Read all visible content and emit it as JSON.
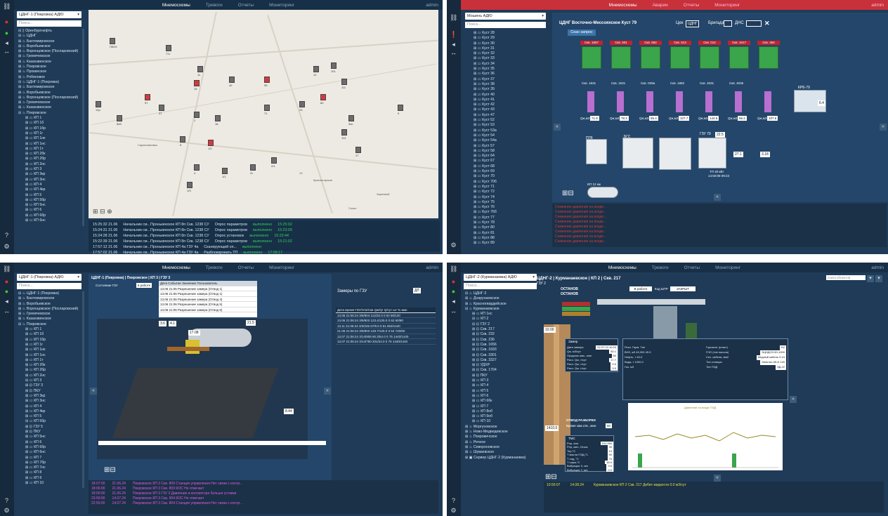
{
  "topnav": {
    "mnemo": "Мнемосхемы",
    "alarms": "Тревоги",
    "reports": "Отчеты",
    "monitoring": "Мониторинг",
    "user": "admin",
    "alarms2": "Аварии"
  },
  "q1": {
    "select": "ЦДНГ-1 (Покровка) АДЮ",
    "search": "Поиск...",
    "tree": [
      "⊟ ▯ Оренбургнефть",
      "⊟ ♨ ЦДНГ",
      "⊞ ♨ Бахтемировское",
      "⊞ ♨ Воробьевское",
      "⊞ ♨ Воронцовское (Посларовский)",
      "⊞ ♨ Гремячевское",
      "⊞ ♨ Казахзвенское",
      "⊞ ♨ Покровское",
      "⊞ ♨ Прокинское",
      "⊞ ♨ Рябиновое",
      "⊟ ♨ ЦДНГ-1 (Покровка)",
      "⊞ ♨ Бахтемировское",
      "⊞ ♨ Воробьевское",
      "⊞ ♨ Воронцовское (Посларовский)",
      "⊞ ♨ Гремячевское",
      "⊞ ♨ Казахзвенское",
      "⊟ ♨ Покровское",
      "⊞ ▭ КП 1",
      "⊞ ▭ КП 1б",
      "⊞ ▭ КП 1бр",
      "⊞ ▭ КП 1г",
      "⊞ ▭ КП 1нк",
      "⊞ ▭ КП 1нс",
      "⊞ ▭ КП 1т",
      "⊞ ▭ КП 2бк",
      "⊞ ▭ КП 2бр",
      "⊞ ▭ КП 2нс",
      "⊞ ▭ КП 3",
      "⊞ ▭ КП 3кр",
      "⊞ ▭ КП 3нс",
      "⊞ ▭ КП 4",
      "⊞ ▭ КП 4кр",
      "⊞ ▭ КП 5",
      "⊞ ▭ КП 5бр",
      "⊞ ▭ КП 5нс",
      "⊞ ▭ КП 6",
      "⊞ ▭ КП 6бр",
      "⊞ ▭ КП 6нс"
    ],
    "map_labels": [
      "ПКОХ",
      "71т",
      "11",
      "15",
      "42",
      "95",
      "12",
      "101",
      "111",
      "12р",
      "84б",
      "97",
      "37",
      "1",
      "18",
      "71",
      "23",
      "60",
      "3нс",
      "9",
      "101",
      "17",
      "5",
      "1/2",
      "4",
      "1/1",
      "3т",
      "1/3",
      "2/1",
      "13",
      "Красногорское",
      "Заречный",
      "Сокол",
      "Сарыпъяновка"
    ],
    "log": [
      {
        "time": "15:25:32 21.06",
        "src": "Начальник см...Пронькинское КП 8п Скв. 1238 СУ",
        "event": "Опрос параметров",
        "status": "выполнено",
        "t2": "15:25:02"
      },
      {
        "time": "15:24:31 21.06",
        "src": "Начальник см...Пронькинское КП 8п Скв. 1238 СУ",
        "event": "Опрос параметров",
        "status": "выполнено",
        "t2": "15:23:09"
      },
      {
        "time": "15:24:28 21.06",
        "src": "Начальник см...Пронькинское КП 8п Скв. 1238 СУ",
        "event": "Опрос установок",
        "status": "выполнено",
        "t2": "15:23:44"
      },
      {
        "time": "15:22:39 21.06",
        "src": "Начальник см...Пронькинское КП 8п Скв. 1238 СУ",
        "event": "Опрос параметров",
        "status": "выполнено",
        "t2": "15:21:02"
      },
      {
        "time": "17:57:12 21.06",
        "src": "Начальник см...Пронькинское КП 4а ГЗУ 4а",
        "event": "Сканирующий оп...",
        "status": "выполнено",
        "t2": ""
      },
      {
        "time": "17:57:02 21.06",
        "src": "Начальник см...Пронькинское КП 4а ГЗУ 4а",
        "event": "Разблокировать ТП",
        "status": "выполнено",
        "t2": "17:58:17"
      }
    ]
  },
  "q2": {
    "select": "Мошень АДЮ",
    "search": "Поиск...",
    "tree": [
      "⊞ ▭ Куст 28",
      "⊞ ▭ Куст 29",
      "⊞ ▭ Куст 30",
      "⊞ ▭ Куст 31",
      "⊞ ▭ Куст 32",
      "⊞ ▭ Куст 33",
      "⊞ ▭ Куст 34",
      "⊞ ▭ Куст 35",
      "⊞ ▭ Куст 36",
      "⊞ ▭ Куст 37",
      "⊞ ▭ Куст 38",
      "⊞ ▭ Куст 39",
      "⊞ ▭ Куст 40",
      "⊞ ▭ Куст 41",
      "⊞ ▭ Куст 42",
      "⊞ ▭ Куст 43",
      "⊞ ▭ Куст 47",
      "⊞ ▭ Куст 52",
      "⊞ ▭ Куст 53",
      "⊞ ▭ Куст 53а",
      "⊞ ▭ Куст 54",
      "⊞ ▭ Куст 54а",
      "⊞ ▭ Куст 57",
      "⊞ ▭ Куст 58",
      "⊞ ▭ Куст 64",
      "⊞ ▭ Куст 67",
      "⊞ ▭ Куст 68",
      "⊞ ▭ Куст 69",
      "⊞ ▭ Куст 70",
      "⊞ ▭ Куст 70б",
      "⊞ ▭ Куст 71",
      "⊞ ▭ Куст 72",
      "⊞ ▭ Куст 74",
      "⊞ ▭ Куст 75",
      "⊞ ▭ Куст 76",
      "⊞ ▭ Куст 76б",
      "⊞ ▭ Куст 77",
      "⊞ ▭ Куст 78",
      "⊞ ▭ Куст 80",
      "⊞ ▭ Куст 81",
      "⊞ ▭ Куст 88",
      "⊞ ▭ Куст 89"
    ],
    "title": "ЦДНГ Восточно-Мессояхское Куст 79",
    "ceh_label": "Цех",
    "ceh_value": "ЦДНГ",
    "brig_label": "Бригада",
    "dns_label": "ДНС",
    "scan_btn": "Скан запрос",
    "wells": [
      "Скв. 1567",
      "Скв. 601",
      "Скв. 682",
      "Скв. 613",
      "Скв. 012",
      "Скв. 1617",
      "Скв. 384"
    ],
    "well_counts": [
      "Скв. 1631",
      "Скв. 1531",
      "Скв. 029а",
      "Скв. 1682",
      "Скв. 4031",
      "Скв. 4035"
    ],
    "flows": [
      "Qж,м3",
      "71.8",
      "Qж,м3",
      "78.3",
      "Qж,м3",
      "65.4",
      "Qж,м3",
      "107.7",
      "Qж,м3",
      "144.5",
      "Qж,м3",
      "56.2",
      "Qж,м3",
      "107.6"
    ],
    "krs": "КРБ-79",
    "krs_val": "6.4",
    "bgs": "БГС",
    "pgv": "ПГВ",
    "gzu": "ГЗУ 79",
    "gzu_val": "22.5",
    "gzu_val2": "27.1",
    "gzu_val3": "3.18",
    "tm": "ТП 40 кВт",
    "tm_time": "14:50:08 09:23",
    "tank": "ЕП 12 км",
    "alarms": [
      "Снижение давления на входе...",
      "Снижение давления на входе...",
      "Снижение давления на входе...",
      "Снижение давления на входе...",
      "Снижение давления на входе...",
      "Снижение давления на входе...",
      "Снижение давления на входе...",
      "Снижение давления на входе..."
    ]
  },
  "q3": {
    "select": "ЦДНГ-1 (Покровка) АДЮ",
    "search": "Поиск...",
    "tree": [
      "⊟ ♨ ЦДНГ-1 (Покровка)",
      "⊞ ♨ Бахтемировское",
      "⊞ ♨ Воробьевское",
      "⊞ ♨ Воронцовское (Посларовский)",
      "⊞ ♨ Гремячевское",
      "⊞ ♨ Казахзвенское",
      "⊟ ♨ Покровское",
      "⊞ ▭ КП 1",
      "⊞ ▭ КП 1б",
      "⊞ ▭ КП 1бр",
      "⊞ ▭ КП 1г",
      "⊞ ▭ КП 1нк",
      "⊞ ▭ КП 1нс",
      "⊞ ▭ КП 1т",
      "⊞ ▭ КП 2бк",
      "⊞ ▭ КП 2бр",
      "⊞ ▭ КП 2нс",
      "⊟ ▭ КП 3",
      "⊞ ⊡ ГЗУ 3",
      "⊞ ⊡ ПКУ",
      "⊞ ▭ КП 3кр",
      "⊞ ▭ КП 3нс",
      "⊞ ▭ КП 4",
      "⊞ ▭ КП 4кр",
      "⊞ ▭ КП 5",
      "⊟ ▭ КП 5бр",
      "⊞ ⊡ ГЗУ 5",
      "⊞ ⊡ ПКУ",
      "⊞ ▭ КП 5нс",
      "⊞ ▭ КП 6",
      "⊞ ▭ КП 6бр",
      "⊞ ▭ КП 6нс",
      "⊞ ▭ КП 7",
      "⊞ ▭ КП 7бр",
      "⊞ ▭ КП 7нс",
      "⊞ ▭ КП 8",
      "⊞ ▭ КП 9",
      "⊞ ▭ КП 10"
    ],
    "title": "ЦДНГ-1 (Покровка) | Покровское | КП 3 | ГЗУ 3",
    "state_lbl": "Состояние ГЗУ",
    "state_val": "в работе",
    "zamer_tab": "Замеры по ГЗУ",
    "zamer_unit": "ДЛ",
    "table_head": [
      "Дата время",
      "ГЗУ/Отв/Скв",
      "Qж/Qг",
      "Q/сут",
      "шт",
      "%",
      "мин"
    ],
    "table_rows": [
      [
        "13.06 21:06:24",
        "3/6/804",
        "114/32.0",
        "0",
        "62",
        "60/120"
      ],
      [
        "13.06 21:06:24",
        "3/5/803",
        "123.4/125.0",
        "0",
        "62",
        "60/80"
      ],
      [
        "13.11 21:06:24",
        "3/3/226",
        "67/9.0",
        "0",
        "61",
        "663/1440"
      ],
      [
        "21.06 21:06:24",
        "3/5/803",
        "129.7/125.0",
        "0",
        "64",
        "720/60"
      ],
      [
        "13.07 21:06:24",
        "3/14/808",
        "60.3/54.0",
        "0",
        "75",
        "1440/1440"
      ],
      [
        "13.07 21:06:24",
        "3/14/780",
        "201/24.0",
        "0",
        "75",
        "1440/1440"
      ]
    ],
    "log": [
      {
        "time": "18:07:00",
        "date": "21.06.24",
        "text": "Покровское КП 3 Скв. 809 Станция управления Нет связи с контр..."
      },
      {
        "time": "18:06:00",
        "date": "21.06.24",
        "text": "Покровское КП 3 Скв. 809 КОС Не отвечает"
      },
      {
        "time": "18:00:00",
        "date": "21.06.24",
        "text": "Покровское КП 3 ГЗУ 3 Давление в коллекторе больше уставки"
      },
      {
        "time": "23:59:00",
        "date": "14.07.24",
        "text": "Покровское КП 3 Скв. 904 КОС Не отвечает"
      },
      {
        "time": "22:59:00",
        "date": "14.07.24",
        "text": "Покровское КП 3 Скв. 804 Станция управления Нет связи с контр..."
      }
    ]
  },
  "q4": {
    "select": "ЦДНГ-2 (Курманаевка) АДЮ",
    "search": "Поиск...",
    "tree": [
      "⊟ ♨ ЦДНГ-2",
      "⊞ ♨ Доарунаевское",
      "⊞ ♨ Красногвардейское",
      "⊟ ♨ Курманаевское",
      "⊞ ▭ КП 1нс",
      "⊟ ▭ КП 2",
      "⊟ ⊡ ГЗУ 2",
      "⊞ ⊡ Скв. 217",
      "⊞ ⊡ Скв. 232",
      "⊞ ⊡ Скв. 236",
      "⊞ ⊡ Скв. 1656",
      "⊞ ⊡ Скв. 1693",
      "⊞ ⊡ Скв. 3301",
      "⊞ ⊡ Скв. 3327",
      "⊞ ⊡ УДХР",
      "⊞ ⊡ Скв. 1704",
      "⊞ ⊡ ПКУ",
      "⊞ ▭ КП 3",
      "⊞ ▭ КП 4",
      "⊞ ▭ КП 5",
      "⊞ ▭ КП 6",
      "⊞ ▭ КП 6бк",
      "⊞ ▭ КП 7",
      "⊞ ▭ КП 8нб",
      "⊞ ▭ КП 9нб",
      "⊞ ▭ КП 10",
      "⊞ ♨ Моргуновское",
      "⊞ ♨ Ново-Медведевское",
      "⊞ ♨ Покровичское",
      "⊞ ♨ Речное",
      "⊞ ♨ Североновское",
      "⊞ ♨ Шуваевское",
      "⊞ ▣ Сервер ЦДНГ-2 (Курманаевка)"
    ],
    "title": "ЦДНГ-2 | Курманаевское | КП 2 | Скв. 217",
    "sub": "ГЗУ 2",
    "state1": "ОСТАНОВ",
    "state2": "ОСТАНОВ",
    "base_state": "В работе",
    "code_lbl": "Код ШТР",
    "code_val": "ЗАКРЫТ",
    "depth": "10.00",
    "zamer_title": "Замер",
    "params": [
      "Дата замера",
      "Qж, м3/сут",
      "Продолж.зам., мин",
      "Расч. Qж, т/сут",
      "Расч. Qж, т/сут",
      "Расч. Qж, т/сут"
    ],
    "param_vals": [
      "02.07.24 10:24",
      "50.1",
      "60",
      "17.7",
      "0.0",
      "0.0"
    ],
    "info_rows": [
      [
        "Рекл.",
        "Гарм.",
        "Тип"
      ],
      [
        "ВНЗ, м3",
        "45,000",
        "45.5"
      ],
      [
        "Нефть, т",
        "",
        "40.0"
      ],
      [
        "Вода, т",
        "",
        "1000.0"
      ],
      [
        "Газ, м3",
        "",
        ""
      ]
    ],
    "right_info": [
      [
        "Горизонт (пласт)",
        "Б2"
      ],
      [
        "ГНО (тип насоса)",
        "ЭЦНДОЗ-50-1000"
      ],
      [
        "Сеч. кабеля, мм2",
        "Медный кабель 3-10"
      ],
      [
        "Тип станции",
        "Электон-05 И 140"
      ],
      [
        "Тип ПЭД",
        "ЭД-22"
      ]
    ],
    "otvod": "ОТВОД РАЗБОРКИ",
    "otvod_lbl": "Время зам.отв., мин",
    "otvod_val": "60",
    "tms_title": "ТМС",
    "tms": [
      [
        "Рпр, атм",
        "101.050"
      ],
      [
        "Рпр, мин.,Отказ",
        "30"
      ],
      [
        "Тпр,°С",
        "14"
      ],
      [
        "Т масла ПЭД,°С",
        "50"
      ],
      [
        "Т под, °С",
        "70"
      ],
      [
        "Т норм,°С",
        "16.0"
      ],
      [
        "Вибрация X, м/с",
        "0.0"
      ],
      [
        "Вибрация Y, м/с",
        "0.0"
      ]
    ],
    "log": [
      {
        "time": "10:56:07",
        "date": "14.08.24",
        "text": "Курманаевское КП 2 Скв. 217 Дебит жидкости 0.0 м3/сут"
      }
    ],
    "chart_legend": "Давление на входе ПЭД",
    "search_obj": "поиск объектов"
  }
}
